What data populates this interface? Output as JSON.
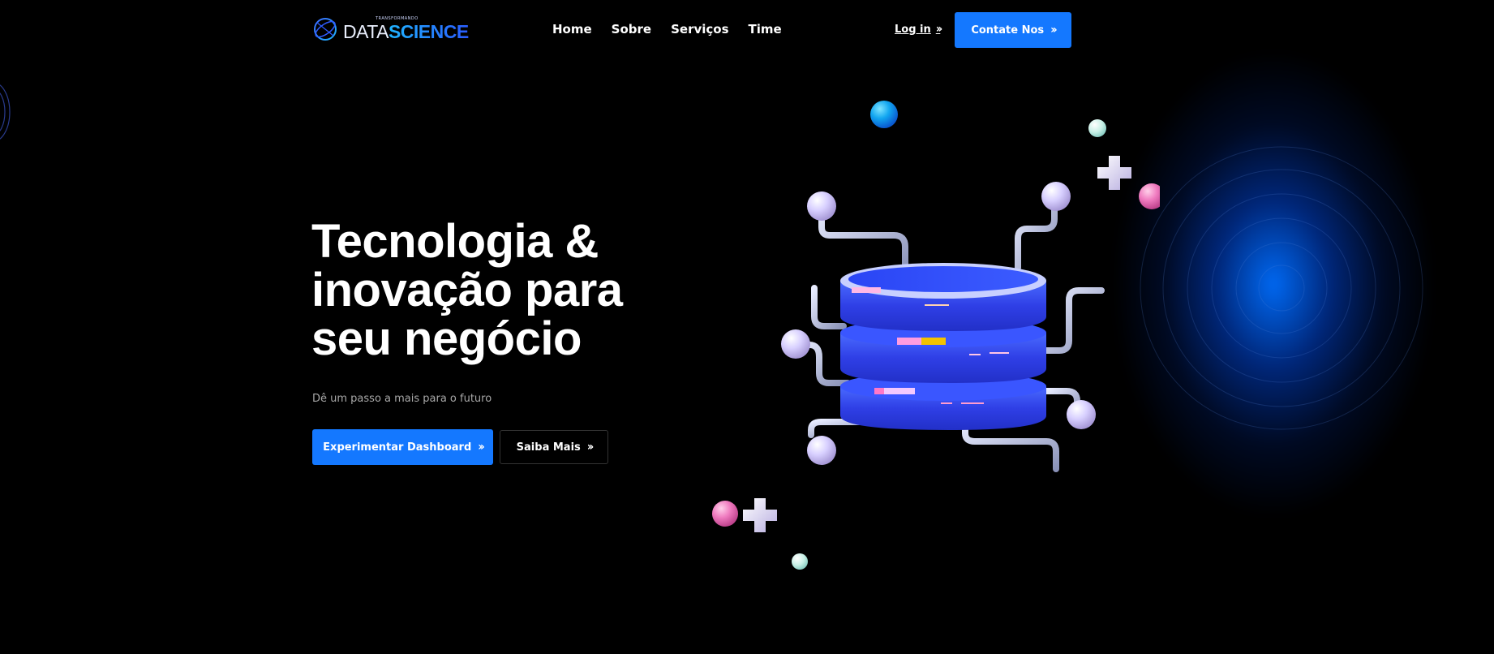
{
  "brand": {
    "tagline": "TRANSFORMANDO",
    "name_part1": "DATA",
    "name_part2": "SCIENCE",
    "logo_icon": "globe-orbit-icon"
  },
  "nav": {
    "items": [
      {
        "label": "Home"
      },
      {
        "label": "Sobre"
      },
      {
        "label": "Serviços"
      },
      {
        "label": "Time"
      }
    ]
  },
  "header": {
    "login_label": "Log in",
    "contact_label": "Contate Nos"
  },
  "hero": {
    "title_lines": [
      "Tecnologia &",
      "inovação para",
      "seu negócio"
    ],
    "subtitle": "Dê um passo a mais para o futuro",
    "primary_button": "Experimentar Dashboard",
    "secondary_button": "Saiba Mais",
    "illustration_icon": "database-server-icon"
  },
  "colors": {
    "accent": "#1478ff",
    "background": "#000000",
    "glow": "#006eff"
  }
}
